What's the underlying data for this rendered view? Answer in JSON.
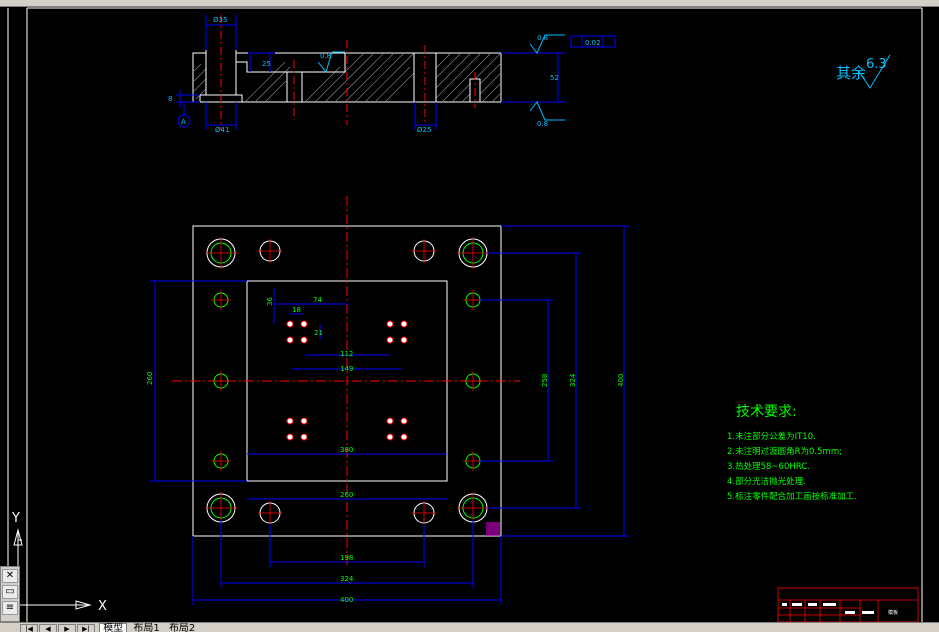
{
  "drawing": {
    "roughness_other": "其余",
    "roughness_other_value": "6.3",
    "section": {
      "dim_top": "Ø35",
      "dim_left_small": "8",
      "dim_inner_25": "25",
      "dim_bottom_left": "Ø41",
      "dim_bottom_mid": "Ø25",
      "dim_right_height": "52",
      "roughness_top": "0.8",
      "roughness_bottom": "0.8",
      "roughness_inner": "0.8",
      "tolerance_box": "0.02",
      "datum_label": "A"
    },
    "plan": {
      "dim_74": "74",
      "dim_18": "18",
      "dim_21": "21",
      "dim_112": "112",
      "dim_149": "149",
      "dim_380": "380",
      "dim_260": "260",
      "dim_198": "198",
      "dim_324_bottom": "324",
      "dim_400_bottom": "400",
      "dim_260_left": "260",
      "dim_258": "258",
      "dim_324_right": "324",
      "dim_400_right": "400",
      "dim_36": "36"
    },
    "tech": {
      "title": "技术要求:",
      "items": [
        "1.未注部分公差为IT10.",
        "2.未注明过渡圆角R为0.5mm;",
        "3.热处理58~60HRC.",
        "4.部分光洁抛光处理.",
        "5.标注零件配合加工画按标准加工."
      ]
    },
    "title_block": {
      "name": "模板"
    }
  },
  "ucs": {
    "x_label": "X",
    "y_label": "Y"
  },
  "tabs": {
    "model": "模型",
    "layout1": "布局1",
    "layout2": "布局2"
  },
  "colors": {
    "background": "#000000",
    "outline": "#ffffff",
    "dimension": "#0000ff",
    "center": "#ff0000",
    "text": "#00ff00",
    "roughness": "#00bfff"
  }
}
